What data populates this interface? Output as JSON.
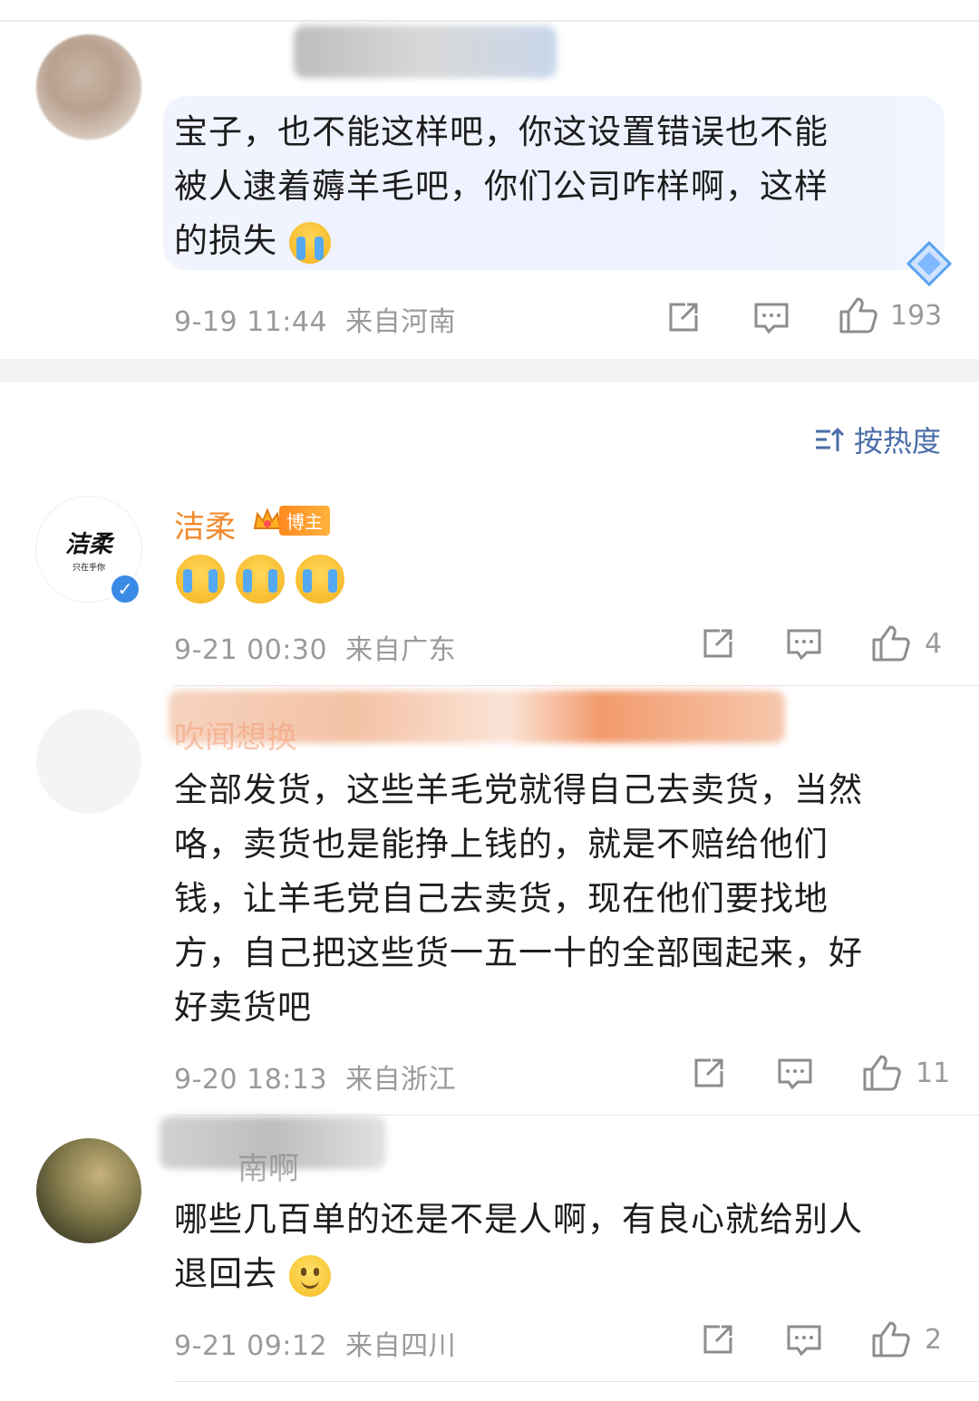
{
  "sort": {
    "label": "按热度"
  },
  "comments": [
    {
      "text": "宝子，也不能这样吧，你这设置错误也不能被人逮着薅羊毛吧，你们公司咋样啊，这样的损失",
      "lines": [
        "宝子，也不能这样吧，你这设置错误也不能",
        "被人逮着薅羊毛吧，你们公司咋样啊，这样",
        "的损失"
      ],
      "emoji": "crying-face",
      "time": "9-19 11:44",
      "location": "来自河南",
      "likes": "193"
    },
    {
      "author": "洁柔",
      "badge": "博主",
      "avatar_logo": "洁柔",
      "avatar_logo_sub": "只在乎你",
      "emojis": [
        "crying-face",
        "crying-face",
        "crying-face"
      ],
      "time": "9-21 00:30",
      "location": "来自广东",
      "likes": "4"
    },
    {
      "author_partial": "吹闻想换",
      "lines": [
        "全部发货，这些羊毛党就得自己去卖货，当然",
        "咯，卖货也是能挣上钱的，就是不赔给他们",
        "钱，让羊毛党自己去卖货，现在他们要找地",
        "方，自己把这些货一五一十的全部囤起来，好",
        "好卖货吧"
      ],
      "time": "9-20 18:13",
      "location": "来自浙江",
      "likes": "11"
    },
    {
      "author_partial": "南啊",
      "lines": [
        "哪些几百单的还是不是人啊，有良心就给别人",
        "退回去"
      ],
      "emoji": "smile-face",
      "time": "9-21 09:12",
      "location": "来自四川",
      "likes": "2"
    }
  ],
  "icons": {
    "share": "share-icon",
    "comment": "comment-icon",
    "like": "thumbs-up-icon",
    "sort": "sort-icon",
    "verified": "verified-icon",
    "crown": "crown-icon",
    "diamond": "diamond-badge-icon"
  },
  "colors": {
    "link_blue": "#4a6ea9",
    "author_orange": "#f28a2e",
    "meta_gray": "#9a9a9a",
    "bubble_bg": "#eef2ff"
  }
}
